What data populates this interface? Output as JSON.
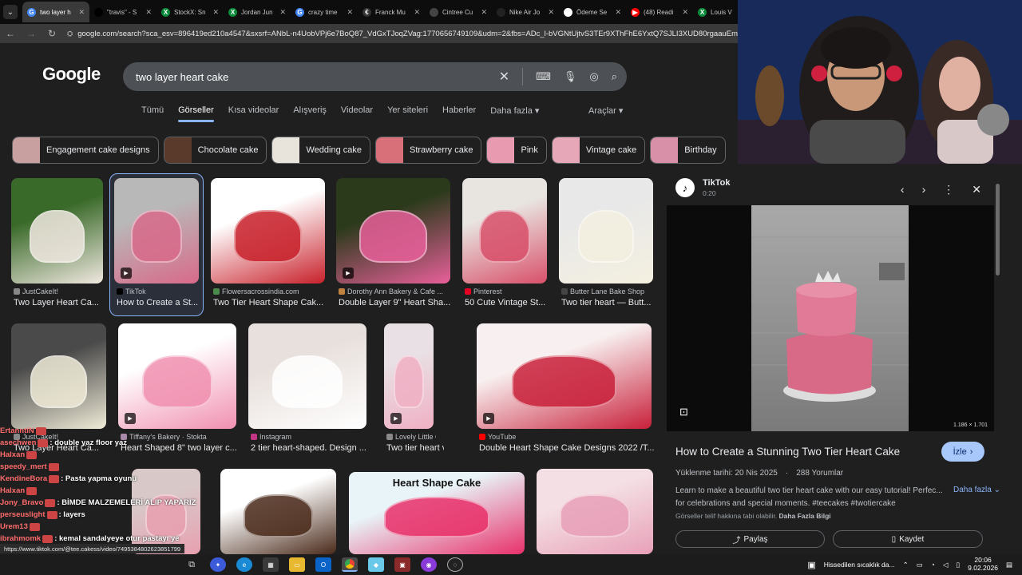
{
  "browser": {
    "tabs": [
      {
        "label": "two layer h",
        "fav": "G",
        "color": "#4285f4",
        "active": true
      },
      {
        "label": "\"travis\" - S",
        "fav": "",
        "color": "#000000",
        "active": false
      },
      {
        "label": "StockX: Sn",
        "fav": "X",
        "color": "#0a8a3a",
        "active": false
      },
      {
        "label": "Jordan Jun",
        "fav": "X",
        "color": "#0a8a3a",
        "active": false
      },
      {
        "label": "crazy time",
        "fav": "G",
        "color": "#4285f4",
        "active": false
      },
      {
        "label": "Franck Mu",
        "fav": "€",
        "color": "#333333",
        "active": false
      },
      {
        "label": "Cintree Cu",
        "fav": "",
        "color": "#444444",
        "active": false
      },
      {
        "label": "Nike Air Jo",
        "fav": "",
        "color": "#222222",
        "active": false
      },
      {
        "label": "Ödeme Se",
        "fav": "●",
        "color": "#ffffff",
        "active": false
      },
      {
        "label": "(48) Readi",
        "fav": "▶",
        "color": "#ff0000",
        "active": false
      },
      {
        "label": "Louis V",
        "fav": "X",
        "color": "#0a8a3a",
        "active": false
      }
    ],
    "url": "google.com/search?sca_esv=896419ed210a4547&sxsrf=ANbL-n4UobVPj6e7BoQ87_VdGxTJoqZVag:1770656749109&udm=2&fbs=ADc_l-bVGNtUjtvS3TEr9XThFhE6YxtQ7SJLI3XUD80rgaauEmGK2Gn8",
    "status_url": "https://www.tiktok.com/@tee.cakess/video/7495384802623851799"
  },
  "google": {
    "logo": "Google",
    "query": "two layer heart cake",
    "nav": [
      "Tümü",
      "Görseller",
      "Kısa videolar",
      "Alışveriş",
      "Videolar",
      "Yer siteleri",
      "Haberler",
      "Daha fazla ▾"
    ],
    "tools": "Araçlar ▾",
    "chips": [
      {
        "label": "Engagement cake designs",
        "color": "#c8a0a0"
      },
      {
        "label": "Chocolate cake",
        "color": "#5a3a2a"
      },
      {
        "label": "Wedding cake",
        "color": "#e8e4dc"
      },
      {
        "label": "Strawberry cake",
        "color": "#d8707a"
      },
      {
        "label": "Pink",
        "color": "#e89ab0"
      },
      {
        "label": "Vintage cake",
        "color": "#e6a8b8"
      },
      {
        "label": "Birthday",
        "color": "#d890a8"
      }
    ],
    "results": [
      {
        "source": "JustCakeIt!",
        "title": "Two Layer Heart Ca...",
        "c1": "#3a6a2a",
        "c2": "#f0e8e0",
        "fav": "#888888",
        "video": false
      },
      {
        "source": "TikTok",
        "title": "How to Create a St...",
        "c1": "#b8b8b8",
        "c2": "#d86a8a",
        "fav": "#000000",
        "video": true
      },
      {
        "source": "Flowersacrossindia.com",
        "title": "Two Tier Heart Shape Cak...",
        "c1": "#ffffff",
        "c2": "#c8202a",
        "fav": "#4a8a4a",
        "video": false
      },
      {
        "source": "Dorothy Ann Bakery & Cafe ...",
        "title": "Double Layer 9\" Heart Sha...",
        "c1": "#2a3a1a",
        "c2": "#e8609a",
        "fav": "#c08040",
        "video": true
      },
      {
        "source": "Pinterest",
        "title": "50 Cute Vintage St...",
        "c1": "#e8e4e0",
        "c2": "#d8506a",
        "fav": "#e60023",
        "video": false
      },
      {
        "source": "Butter Lane Bake Shop",
        "title": "Two tier heart — Butt...",
        "c1": "#e8e8e8",
        "c2": "#f4f0e0",
        "fav": "#444444",
        "video": false
      },
      {
        "source": "JustCakeIt!",
        "title": "Two Layer Heart Ca...",
        "c1": "#4a4a4a",
        "c2": "#f0ecd8",
        "fav": "#888888",
        "video": false
      },
      {
        "source": "Tiffany's Bakery · Stokta",
        "title": "Heart Shaped 8\" two layer c...",
        "c1": "#ffffff",
        "c2": "#f090b0",
        "fav": "#aa88aa",
        "video": true
      },
      {
        "source": "Instagram",
        "title": "2 tier heart-shaped. Design ...",
        "c1": "#e8e0dc",
        "c2": "#ffffff",
        "fav": "#c13584",
        "video": false
      },
      {
        "source": "Lovely Little Cakes ...",
        "title": "Two tier heart vinta...",
        "c1": "#e8e0e4",
        "c2": "#f0b0c4",
        "fav": "#888888",
        "video": true
      },
      {
        "source": "YouTube",
        "title": "Double Heart Shape Cake Designs 2022 /T...",
        "c1": "#f8f0f0",
        "c2": "#c8203a",
        "fav": "#ff0000",
        "video": true
      },
      {
        "source": "",
        "title": "",
        "c1": "#d8c8c8",
        "c2": "#e8a0b0",
        "fav": "#888888",
        "video": false
      },
      {
        "source": "",
        "title": "",
        "c1": "#ffffff",
        "c2": "#4a2a1a",
        "fav": "#888888",
        "video": false
      },
      {
        "source": "",
        "title": "Heart Shape Cake",
        "c1": "#e8f4f8",
        "c2": "#e8306a",
        "fav": "#888888",
        "video": false
      },
      {
        "source": "",
        "title": "",
        "c1": "#f4e0e4",
        "c2": "#e8a0b8",
        "fav": "#888888",
        "video": false
      }
    ]
  },
  "panel": {
    "source": "TikTok",
    "duration": "0:20",
    "dims": "1.186 × 1.701",
    "title": "How to Create a Stunning Two Tier Heart Cake",
    "watch": "İzle",
    "uploaded": "Yüklenme tarihi: 20 Nis 2025",
    "comments": "288 Yorumlar",
    "desc": "Learn to make a beautiful two tier heart cake with our easy tutorial! Perfec... for celebrations and special moments. #teecakes #twotiercake",
    "more": "Daha fazla",
    "copyright": "Görseller telif hakkına tabi olabilir.",
    "copyright_link": "Daha Fazla Bilgi",
    "share": "Paylaş",
    "save": "Kaydet"
  },
  "chat": [
    {
      "user": "ErtanntiN",
      "msg": ""
    },
    {
      "user": "asechwen",
      "msg": ": double yaz floor yaz"
    },
    {
      "user": "Halxan",
      "msg": ""
    },
    {
      "user": "speedy_mert",
      "msg": ""
    },
    {
      "user": "KendineBora",
      "msg": ": Pasta yapma oyunu"
    },
    {
      "user": "Halxan",
      "msg": ""
    },
    {
      "user": "Jony_Bravo",
      "msg": ": BİMDE MALZEMELERİ ALIP YAPARIZ"
    },
    {
      "user": "perseuslight",
      "msg": ": layers"
    },
    {
      "user": "Urem13",
      "msg": ""
    },
    {
      "user": "ibrahmomk",
      "msg": ": kemal sandalyeye otur pastayı ye"
    }
  ],
  "taskbar": {
    "weather": "Hissedilen sıcaklık da...",
    "time": "20:06",
    "date": "9.02.2026"
  }
}
